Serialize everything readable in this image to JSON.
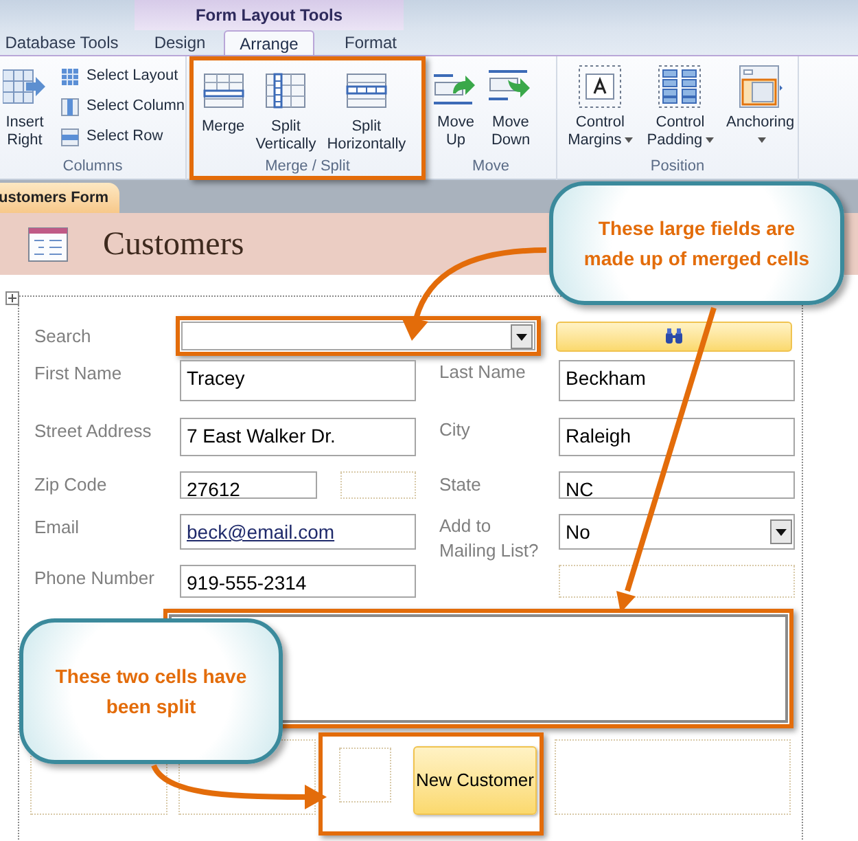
{
  "window": {
    "contextual_group": "Form Layout Tools"
  },
  "tabs": [
    {
      "label": "Database Tools",
      "selected": false
    },
    {
      "label": "Design",
      "selected": false
    },
    {
      "label": "Arrange",
      "selected": true
    },
    {
      "label": "Format",
      "selected": false
    }
  ],
  "ribbon": {
    "groups": [
      {
        "label": "Columns",
        "highlighted": false,
        "buttons": [
          {
            "kind": "large",
            "label": "Insert Right"
          },
          {
            "kind": "small",
            "label": "Select Layout"
          },
          {
            "kind": "small",
            "label": "Select Column"
          },
          {
            "kind": "small",
            "label": "Select Row"
          }
        ]
      },
      {
        "label": "Merge / Split",
        "highlighted": true,
        "buttons": [
          {
            "kind": "large",
            "label": "Merge"
          },
          {
            "kind": "large",
            "label": "Split Vertically"
          },
          {
            "kind": "large",
            "label": "Split Horizontally"
          }
        ]
      },
      {
        "label": "Move",
        "highlighted": false,
        "buttons": [
          {
            "kind": "large",
            "label": "Move Up"
          },
          {
            "kind": "large",
            "label": "Move Down"
          }
        ]
      },
      {
        "label": "Position",
        "highlighted": false,
        "buttons": [
          {
            "kind": "dropdown",
            "label": "Control Margins"
          },
          {
            "kind": "dropdown",
            "label": "Control Padding"
          },
          {
            "kind": "dropdown",
            "label": "Anchoring"
          }
        ]
      }
    ]
  },
  "document_tab": {
    "label": "ustomers Form"
  },
  "form": {
    "title": "Customers",
    "search": {
      "label": "Search",
      "highlighted": true
    },
    "rows": [
      {
        "left": {
          "label": "First Name",
          "value": "Tracey",
          "kind": "text"
        },
        "right": {
          "label": "Last Name",
          "value": "Beckham",
          "kind": "text"
        }
      },
      {
        "left": {
          "label": "Street Address",
          "value": "7 East Walker Dr.",
          "kind": "text"
        },
        "right": {
          "label": "City",
          "value": "Raleigh",
          "kind": "text"
        }
      },
      {
        "left": {
          "label": "Zip Code",
          "value": "27612",
          "kind": "short"
        },
        "right": {
          "label": "State",
          "value": "NC",
          "kind": "text"
        }
      },
      {
        "left": {
          "label": "Email",
          "value": "beck@email.com",
          "kind": "link"
        },
        "right": {
          "label": "Add to Mailing List?",
          "value": "No",
          "kind": "combo"
        }
      },
      {
        "left": {
          "label": "Phone Number",
          "value": "919-555-2314",
          "kind": "text"
        }
      }
    ],
    "merged_field": {
      "highlighted": true
    },
    "split_cells": {
      "highlighted": true
    },
    "button": {
      "label": "New Customer"
    }
  },
  "callouts": [
    {
      "text": "These large fields are made up of merged cells"
    },
    {
      "text": "These two cells have been split"
    }
  ]
}
